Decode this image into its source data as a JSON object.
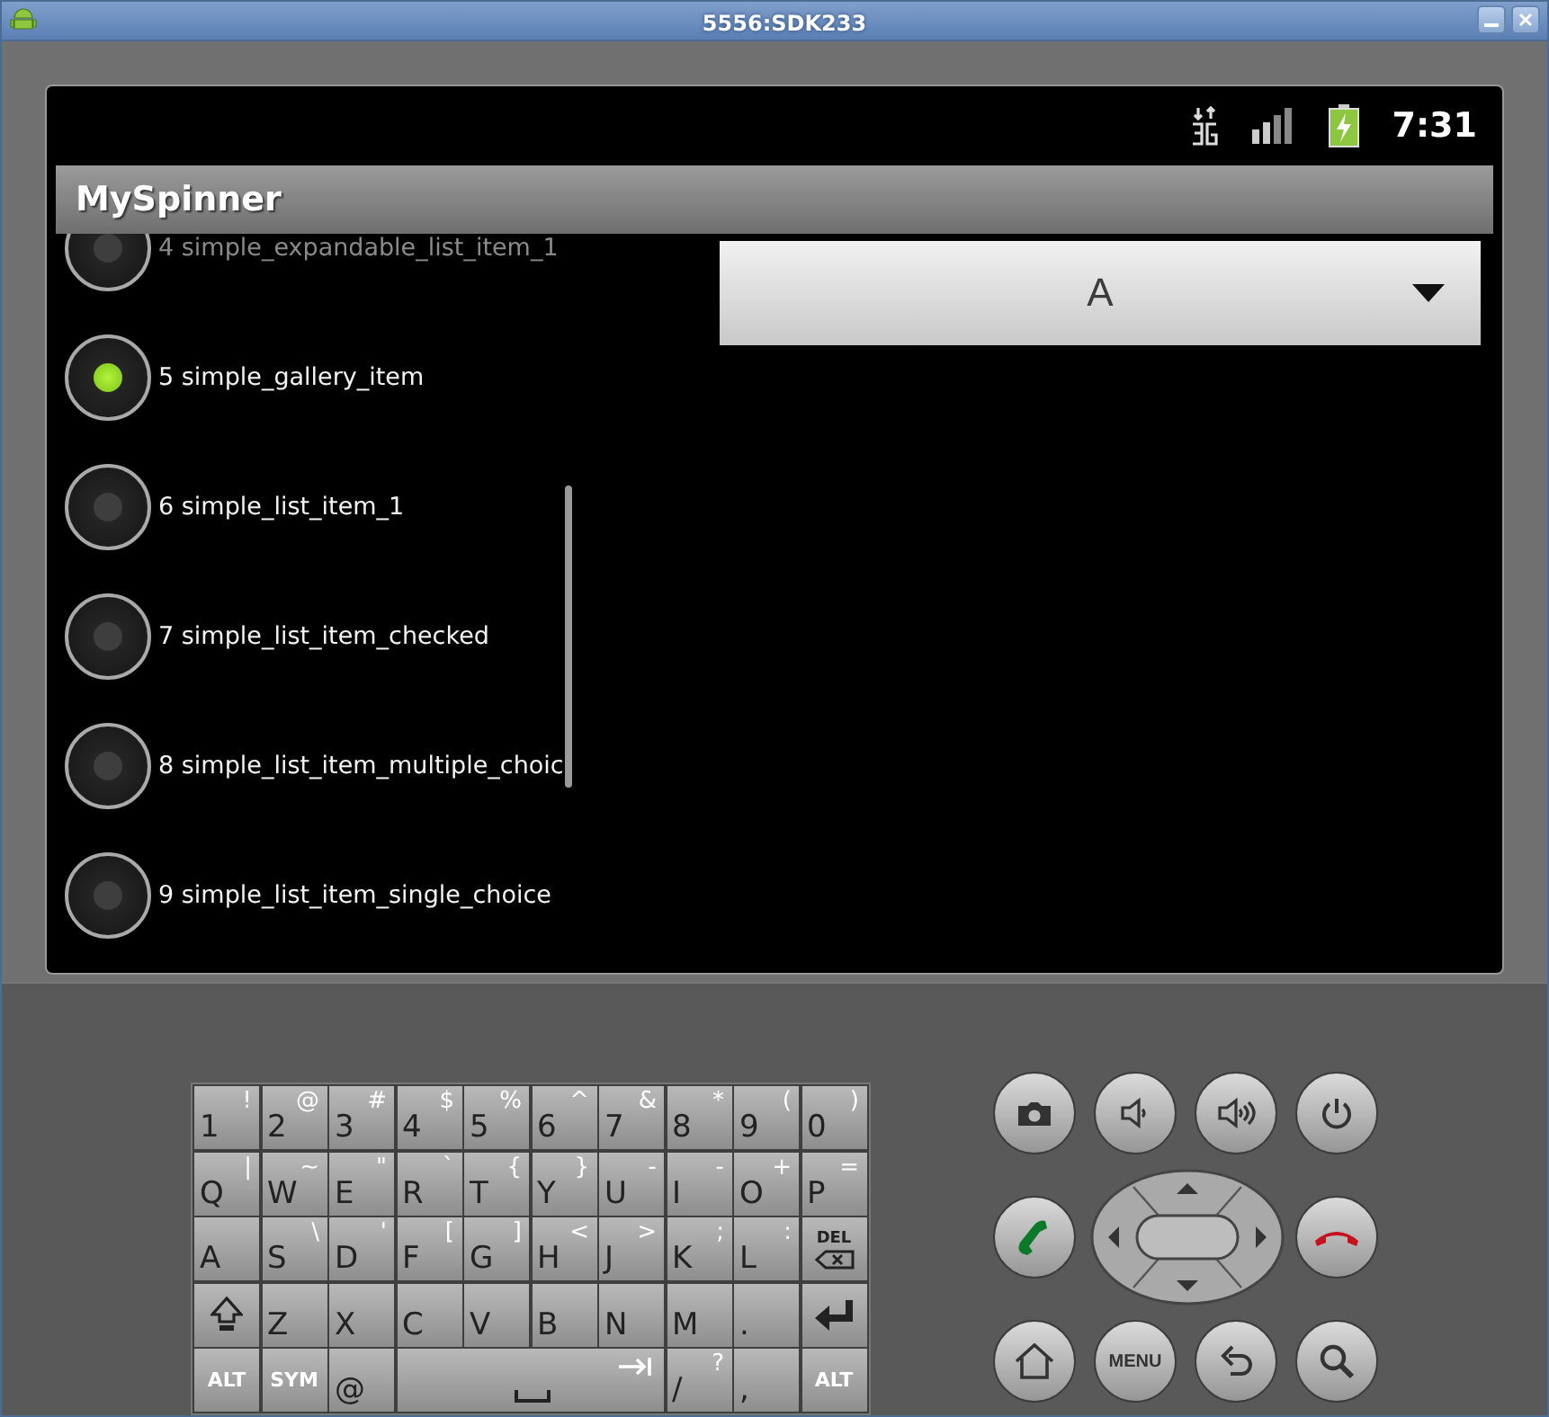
{
  "window": {
    "title": "5556:SDK233"
  },
  "status_bar": {
    "time": "7:31"
  },
  "app": {
    "title": "MySpinner"
  },
  "list": [
    {
      "label": "4 simple_expandable_list_item_1",
      "selected": false,
      "faded": true
    },
    {
      "label": "5 simple_gallery_item",
      "selected": true,
      "faded": false
    },
    {
      "label": "6 simple_list_item_1",
      "selected": false,
      "faded": false
    },
    {
      "label": "7 simple_list_item_checked",
      "selected": false,
      "faded": false
    },
    {
      "label": "8 simple_list_item_multiple_choic",
      "selected": false,
      "faded": false
    },
    {
      "label": "9 simple_list_item_single_choice",
      "selected": false,
      "faded": false
    }
  ],
  "spinner": {
    "value": "A"
  },
  "keyboard": [
    [
      {
        "kind": "char",
        "label": "1",
        "alt": "!"
      },
      {
        "kind": "char",
        "label": "2",
        "alt": "@"
      },
      {
        "kind": "char",
        "label": "3",
        "alt": "#"
      },
      {
        "kind": "char",
        "label": "4",
        "alt": "$"
      },
      {
        "kind": "char",
        "label": "5",
        "alt": "%"
      },
      {
        "kind": "char",
        "label": "6",
        "alt": "^"
      },
      {
        "kind": "char",
        "label": "7",
        "alt": "&"
      },
      {
        "kind": "char",
        "label": "8",
        "alt": "*"
      },
      {
        "kind": "char",
        "label": "9",
        "alt": "("
      },
      {
        "kind": "char",
        "label": "0",
        "alt": ")"
      }
    ],
    [
      {
        "kind": "char",
        "label": "Q",
        "alt": "|"
      },
      {
        "kind": "char",
        "label": "W",
        "alt": "~"
      },
      {
        "kind": "char",
        "label": "E",
        "alt": "\""
      },
      {
        "kind": "char",
        "label": "R",
        "alt": "`"
      },
      {
        "kind": "char",
        "label": "T",
        "alt": "{"
      },
      {
        "kind": "char",
        "label": "Y",
        "alt": "}"
      },
      {
        "kind": "char",
        "label": "U",
        "alt": "-"
      },
      {
        "kind": "char",
        "label": "I",
        "alt": "-"
      },
      {
        "kind": "char",
        "label": "O",
        "alt": "+"
      },
      {
        "kind": "char",
        "label": "P",
        "alt": "="
      }
    ],
    [
      {
        "kind": "char",
        "label": "A"
      },
      {
        "kind": "char",
        "label": "S",
        "alt": "\\"
      },
      {
        "kind": "char",
        "label": "D",
        "alt": "'"
      },
      {
        "kind": "char",
        "label": "F",
        "alt": "["
      },
      {
        "kind": "char",
        "label": "G",
        "alt": "]"
      },
      {
        "kind": "char",
        "label": "H",
        "alt": "<"
      },
      {
        "kind": "char",
        "label": "J",
        "alt": ">"
      },
      {
        "kind": "char",
        "label": "K",
        "alt": ";"
      },
      {
        "kind": "char",
        "label": "L",
        "alt": ":"
      },
      {
        "kind": "del",
        "label": "DEL"
      }
    ],
    [
      {
        "kind": "shift"
      },
      {
        "kind": "char",
        "label": "Z"
      },
      {
        "kind": "char",
        "label": "X"
      },
      {
        "kind": "char",
        "label": "C"
      },
      {
        "kind": "char",
        "label": "V"
      },
      {
        "kind": "char",
        "label": "B"
      },
      {
        "kind": "char",
        "label": "N"
      },
      {
        "kind": "char",
        "label": "M"
      },
      {
        "kind": "char",
        "label": "."
      },
      {
        "kind": "enter"
      }
    ],
    [
      {
        "kind": "mod",
        "label": "ALT"
      },
      {
        "kind": "mod",
        "label": "SYM"
      },
      {
        "kind": "char",
        "label": "@"
      },
      {
        "kind": "space"
      },
      {
        "kind": "char",
        "label": "/",
        "alt": "?"
      },
      {
        "kind": "char",
        "label": ","
      },
      {
        "kind": "mod",
        "label": "ALT"
      }
    ]
  ],
  "controls": [
    {
      "kind": "camera"
    },
    {
      "kind": "volume-down"
    },
    {
      "kind": "volume-up"
    },
    {
      "kind": "power"
    },
    {
      "kind": "call"
    },
    {
      "kind": "dpad"
    },
    {
      "kind": "end-call"
    },
    {
      "kind": "home"
    },
    {
      "kind": "menu",
      "label": "MENU"
    },
    {
      "kind": "back"
    },
    {
      "kind": "search"
    }
  ]
}
